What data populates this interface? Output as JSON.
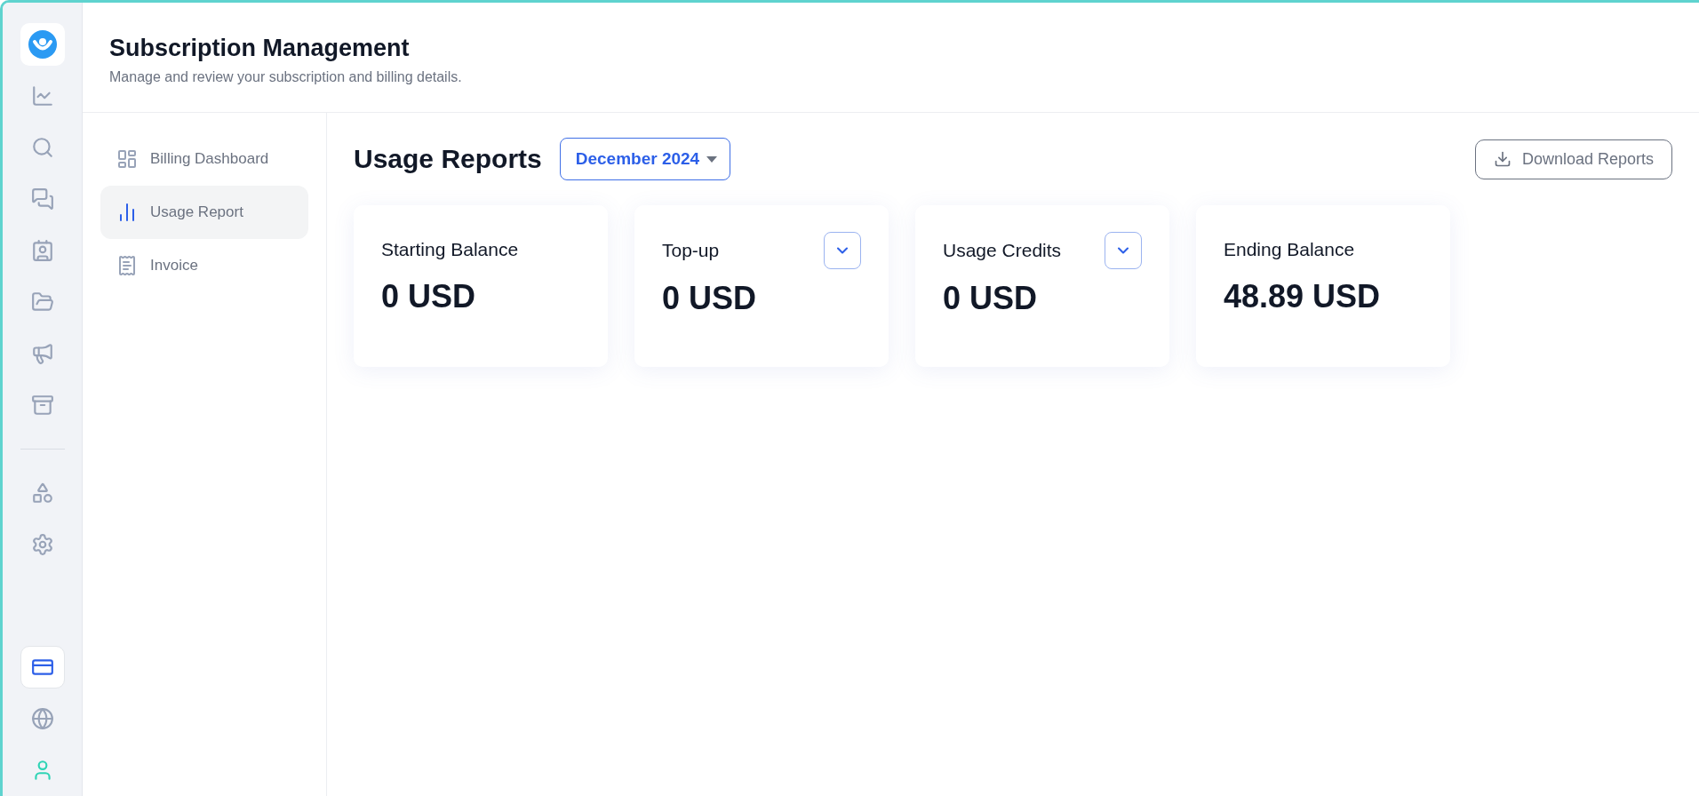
{
  "rail": {
    "top": [
      {
        "selected": false
      },
      {
        "selected": false
      },
      {
        "selected": false
      },
      {
        "selected": false
      },
      {
        "selected": false
      },
      {
        "selected": false
      },
      {
        "selected": false
      },
      {
        "selected": false
      }
    ],
    "middle": [
      {
        "selected": false
      },
      {
        "selected": false
      }
    ],
    "bottom": [
      {
        "selected": true
      },
      {
        "selected": false
      },
      {
        "selected": false
      }
    ]
  },
  "header": {
    "title": "Subscription Management",
    "subtitle": "Manage and review your subscription and billing details."
  },
  "subnav": [
    {
      "label": "Billing Dashboard",
      "selected": false
    },
    {
      "label": "Usage Report",
      "selected": true
    },
    {
      "label": "Invoice",
      "selected": false
    }
  ],
  "report": {
    "title": "Usage Reports",
    "period": "December 2024",
    "download": "Download Reports",
    "cards": [
      {
        "kind": "plain",
        "label": "Starting Balance",
        "value": "0 USD"
      },
      {
        "kind": "expandable",
        "label": "Top-up",
        "value": "0 USD"
      },
      {
        "kind": "expandable",
        "label": "Usage Credits",
        "value": "0 USD"
      },
      {
        "kind": "plain",
        "label": "Ending Balance",
        "value": "48.89 USD"
      }
    ]
  }
}
